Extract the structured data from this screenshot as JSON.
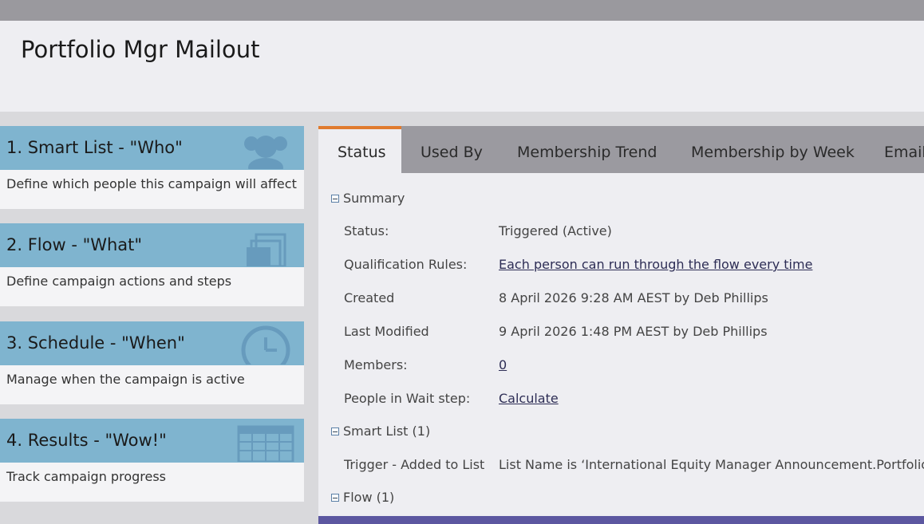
{
  "page": {
    "title": "Portfolio Mgr Mailout"
  },
  "cards": [
    {
      "title": "1. Smart List - \"Who\"",
      "desc": "Define which people this campaign will affect",
      "icon": "people-icon"
    },
    {
      "title": "2. Flow - \"What\"",
      "desc": "Define campaign actions and steps",
      "icon": "stack-icon"
    },
    {
      "title": "3. Schedule - \"When\"",
      "desc": "Manage when the campaign is active",
      "icon": "clock-icon"
    },
    {
      "title": "4. Results - \"Wow!\"",
      "desc": "Track campaign progress",
      "icon": "table-icon"
    }
  ],
  "tabs": [
    "Status",
    "Used By",
    "Membership Trend",
    "Membership by Week",
    "Email"
  ],
  "active_tab": "Status",
  "sections": {
    "summary": "Summary",
    "smart_list": "Smart List (1)",
    "flow": "Flow (1)"
  },
  "summary_rows": [
    {
      "label": "Status:",
      "value": "Triggered (Active)"
    },
    {
      "label": "Qualification Rules:",
      "value": "Each person can run through the flow every time"
    },
    {
      "label": "Created",
      "value": "8 April 2026 9:28 AM AEST by Deb Phillips"
    },
    {
      "label": "Last Modified",
      "value": "9 April 2026 1:48 PM AEST by Deb Phillips"
    },
    {
      "label": "Members:",
      "value": "0"
    },
    {
      "label": "People in Wait step:",
      "value": "Calculate"
    }
  ],
  "smart_list_rows": [
    {
      "label": "Trigger - Added to List",
      "value": "List Name is ‘International Equity Manager Announcement.Portfolio Mg..."
    }
  ],
  "colors": {
    "card_header": "#7fb4cf",
    "active_tab_accent": "#e07a2e",
    "tab_bar": "#9b9aa0",
    "bottom_bar": "#5c57a0"
  }
}
